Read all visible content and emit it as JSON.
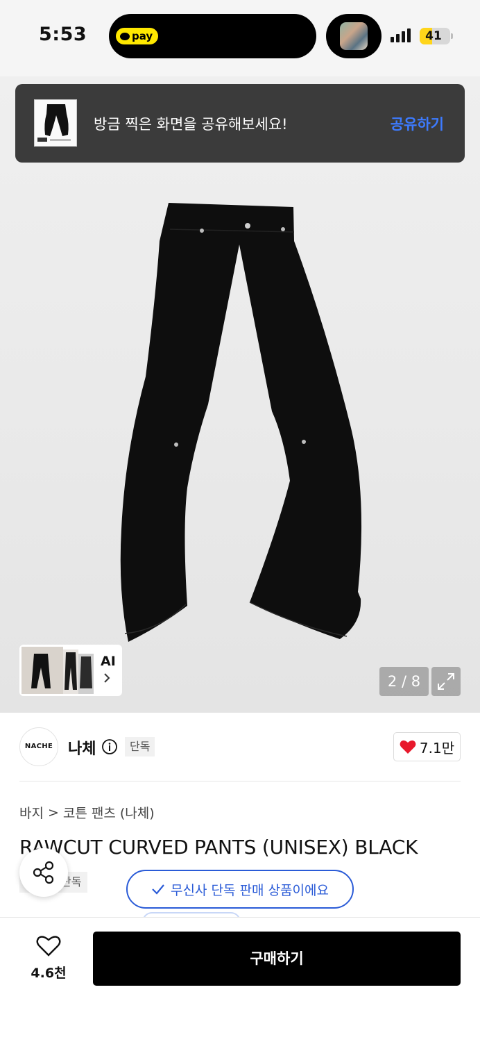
{
  "status_bar": {
    "time": "5:53",
    "pay_label": "pay",
    "battery": "41",
    "battery_level": 0.41
  },
  "share_toast": {
    "message": "방금 찍은 화면을 공유해보세요!",
    "action": "공유하기"
  },
  "gallery": {
    "ai_label": "AI",
    "counter": "2 / 8"
  },
  "brand": {
    "logo_text": "NACHE",
    "name": "나체",
    "badge": "단독",
    "likes": "7.1만"
  },
  "breadcrumb": {
    "category": "바지",
    "separator": ">",
    "subcategory": "코튼 팬츠 (나체)"
  },
  "product": {
    "title": "RAWCUT CURVED PANTS (UNISEX) BLACK",
    "badge": "단독",
    "verified_label": "무신사 단독 판매 상품이에요"
  },
  "bottom_bar": {
    "wish_count": "4.6천",
    "buy_label": "구매하기"
  },
  "colors": {
    "accent_blue": "#2a5bd7",
    "toast_link": "#3d7bff",
    "heart_red": "#e8192c",
    "battery_yellow": "#ffd51a"
  },
  "icons": [
    "pay-icon",
    "signal-icon",
    "info-icon",
    "heart-icon",
    "chevron-right-icon",
    "expand-icon",
    "share-icon",
    "check-icon",
    "heart-outline-icon"
  ]
}
